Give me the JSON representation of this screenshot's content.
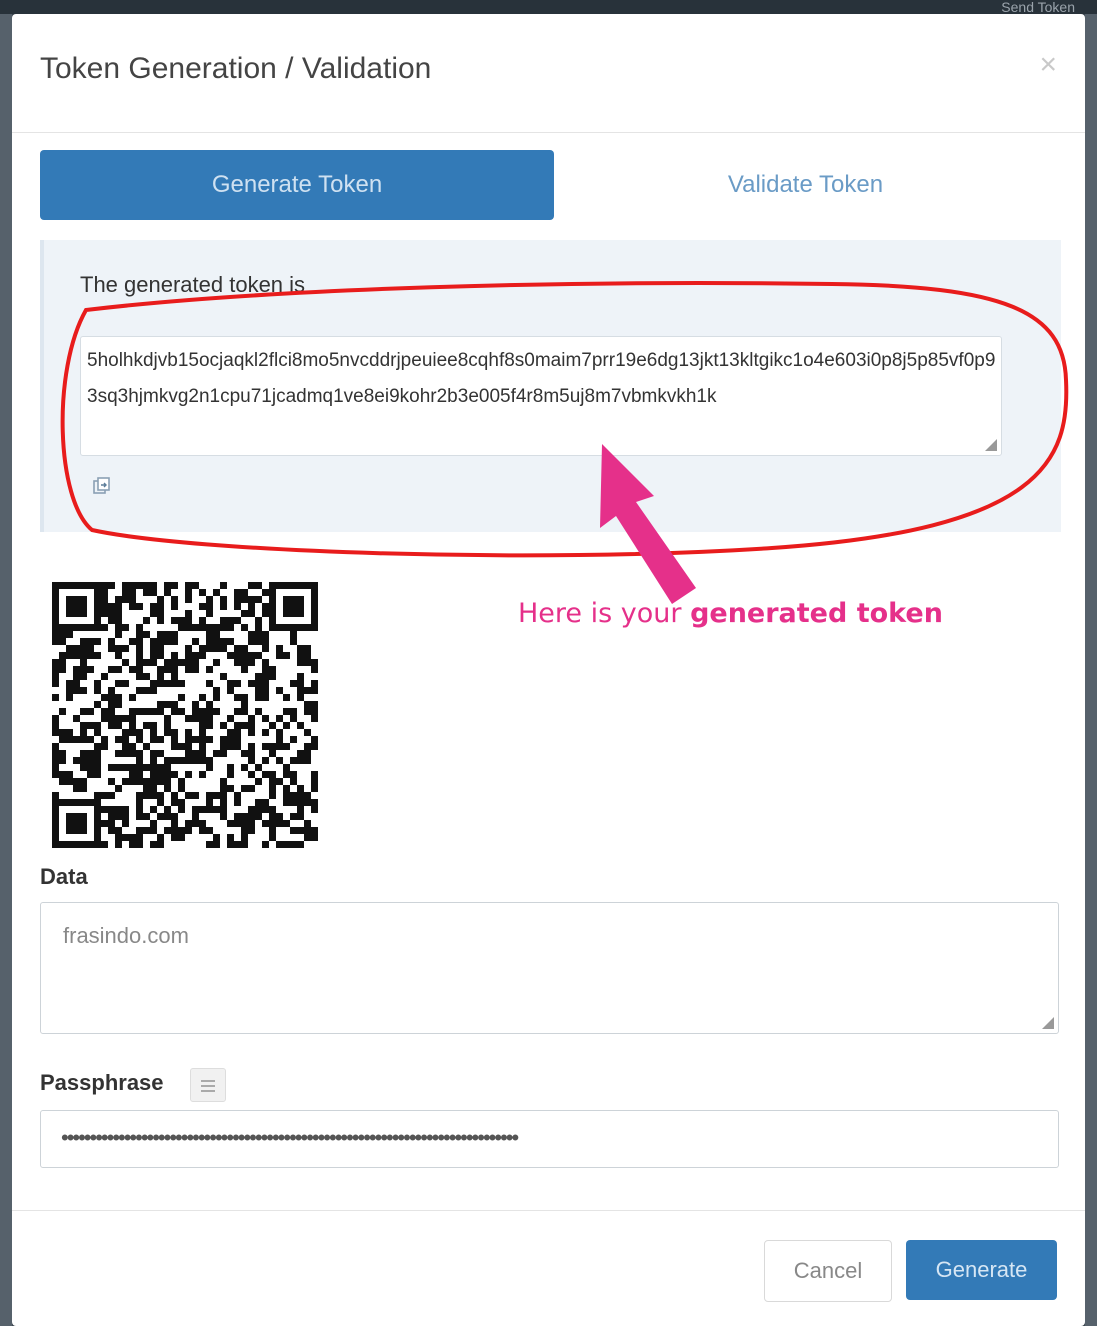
{
  "background": {
    "top_right_text": "Send Token"
  },
  "modal": {
    "title": "Token Generation / Validation",
    "close_label": "×"
  },
  "tabs": [
    {
      "label": "Generate Token",
      "active": true
    },
    {
      "label": "Validate Token",
      "active": false
    }
  ],
  "token": {
    "label": "The generated token is",
    "value": "5holhkdjvb15ocjaqkl2flci8mo5nvcddrjpeuiee8cqhf8s0maim7prr19e6dg13jkt13kltgikc1o4e603i0p8j5p85vf0p93sq3hjmkvg2n1cpu71jcadmq1ve8ei9kohr2b3e005f4r8m5uj8m7vbmkvkh1k"
  },
  "annotation": {
    "text_prefix": "Here is your ",
    "text_bold": "generated token",
    "ellipse_color": "#e81c1c",
    "arrow_color": "#e5308a"
  },
  "form": {
    "data_label": "Data",
    "data_value": "frasindo.com",
    "passphrase_label": "Passphrase",
    "passphrase_value": "••••••••••••••••••••••••••••••••••••••••••••••••••••••••••••••••••••••••••••••••"
  },
  "buttons": {
    "cancel": "Cancel",
    "generate": "Generate"
  },
  "colors": {
    "primary": "#337ab7",
    "panel_bg": "#eef3f8"
  },
  "icons": {
    "copy": "copy-icon",
    "help": "help-icon",
    "close": "close-icon"
  }
}
